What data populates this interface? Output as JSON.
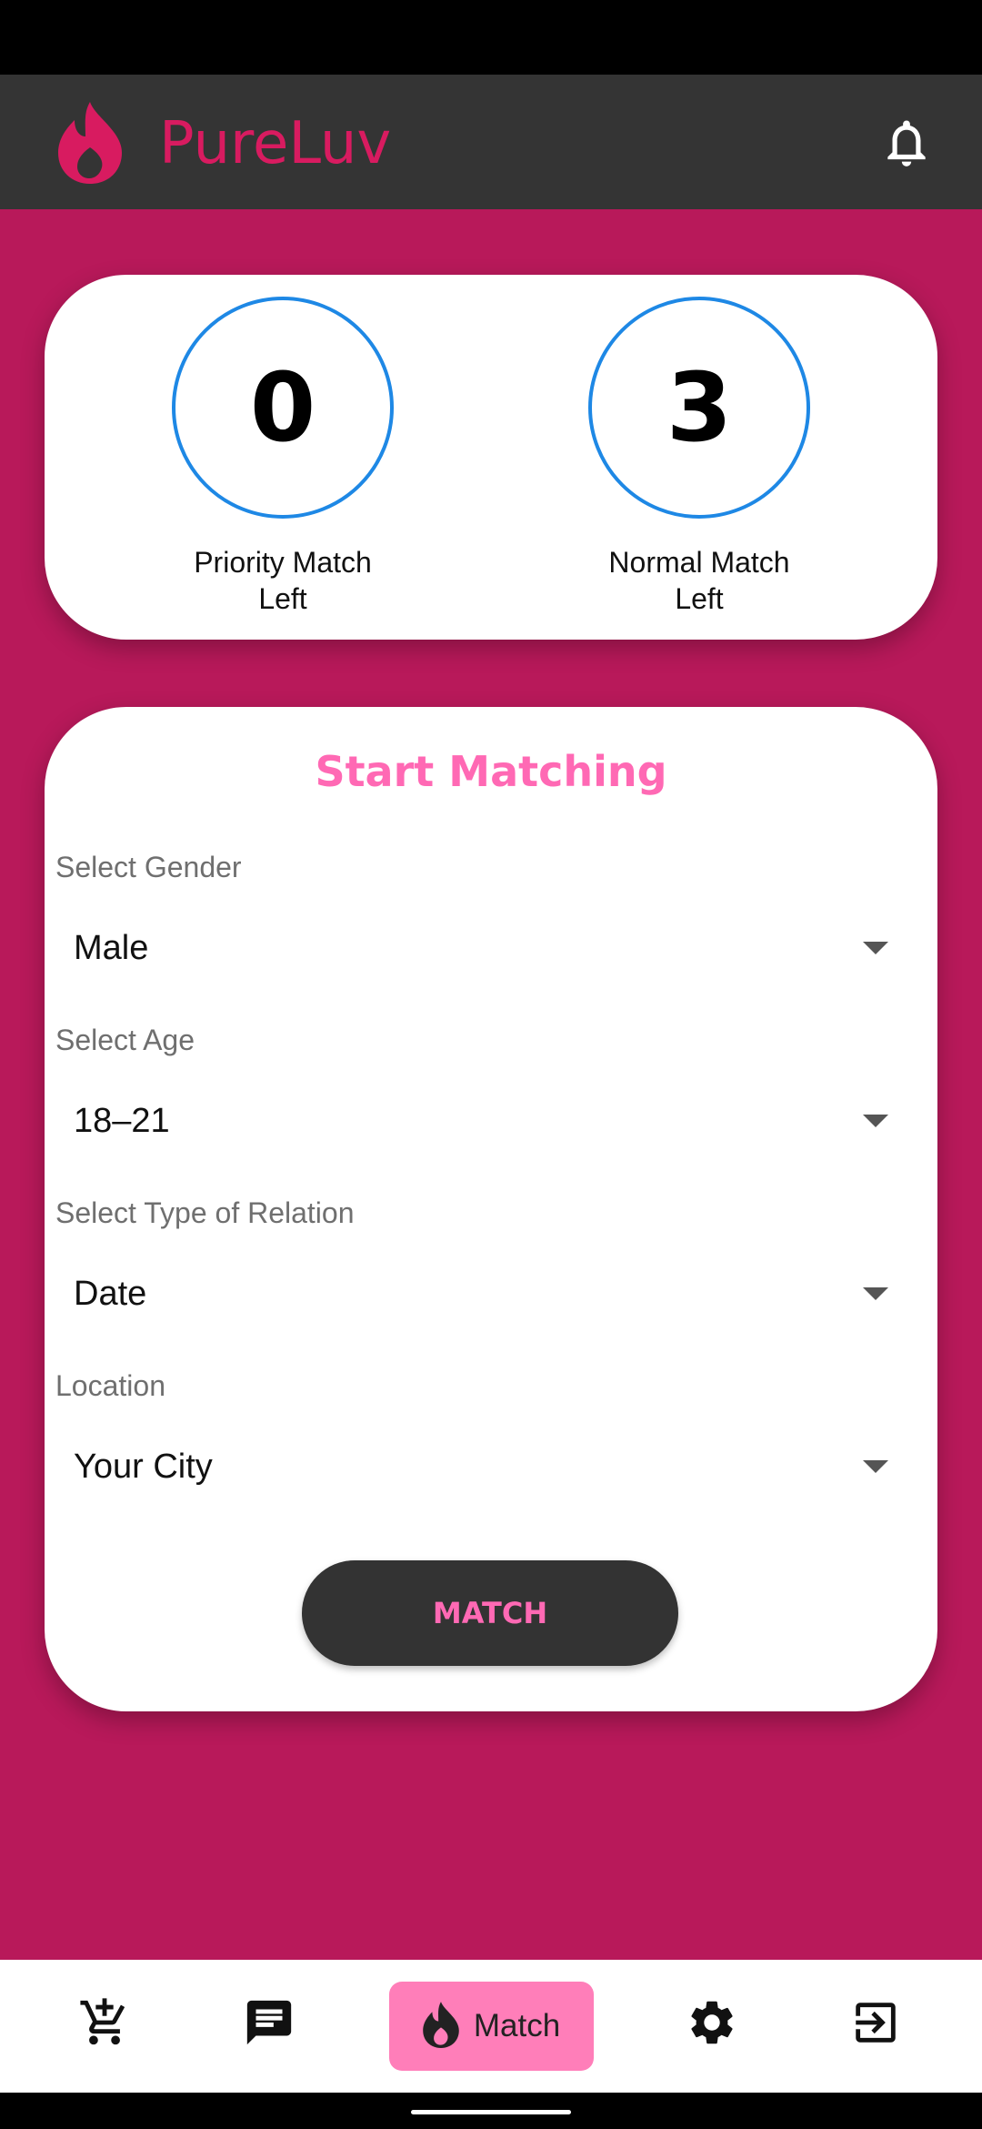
{
  "app": {
    "title": "PureLuv",
    "brand_color": "#d81b60",
    "accent_pink": "#ff69b4"
  },
  "stats": {
    "priority": {
      "value": "0",
      "label_line1": "Priority Match",
      "label_line2": "Left"
    },
    "normal": {
      "value": "3",
      "label_line1": "Normal Match",
      "label_line2": "Left"
    }
  },
  "form": {
    "title": "Start Matching",
    "fields": [
      {
        "label": "Select Gender",
        "value": "Male"
      },
      {
        "label": "Select Age",
        "value": "18–21"
      },
      {
        "label": "Select Type of Relation",
        "value": "Date"
      },
      {
        "label": "Location",
        "value": "Your City"
      }
    ],
    "submit_label": "MATCH"
  },
  "nav": {
    "items": [
      {
        "icon": "add-to-cart-icon"
      },
      {
        "icon": "chat-icon"
      },
      {
        "icon": "flame-icon",
        "label": "Match",
        "active": true
      },
      {
        "icon": "settings-icon"
      },
      {
        "icon": "logout-icon"
      }
    ]
  }
}
